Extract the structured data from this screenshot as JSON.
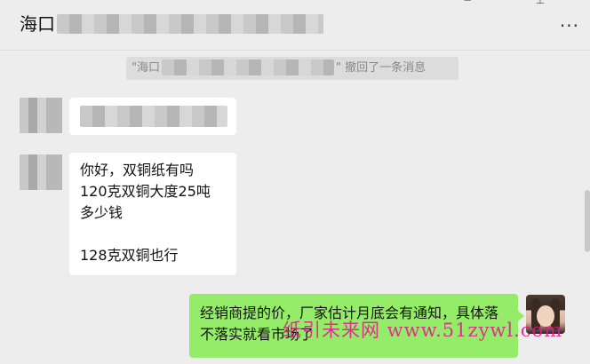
{
  "header": {
    "title": "海口",
    "more_label": "···"
  },
  "recall_notice": {
    "prefix": "\"海口",
    "suffix": "\" 撤回了一条消息"
  },
  "messages": {
    "incoming_2": {
      "lines": [
        "你好，双铜纸有吗",
        "120克双铜大度25吨",
        "多少钱",
        "128克双铜也行"
      ]
    },
    "outgoing_1": {
      "text": "经销商提的价，厂家估计月底会有通知，具体落不落实就看市场了"
    }
  },
  "watermark": {
    "text": "纸引未来网 www.51zywl.com"
  }
}
